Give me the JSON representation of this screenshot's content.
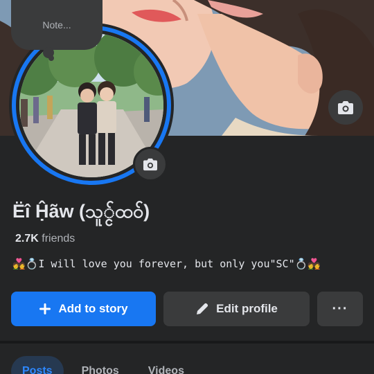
{
  "note": {
    "label": "Note..."
  },
  "profile": {
    "name": "Ëî Ḥ̂ãw (သူ္င်ထ၀်)",
    "friends_count": "2.7K",
    "friends_label": "friends",
    "bio": "💑💍I will love you forever, but only you\"SC\"💍💑"
  },
  "actions": {
    "add_story": "Add to story",
    "edit_profile": "Edit profile",
    "more": "···"
  },
  "tabs": [
    {
      "label": "Posts",
      "active": true
    },
    {
      "label": "Photos",
      "active": false
    },
    {
      "label": "Videos",
      "active": false
    }
  ],
  "colors": {
    "accent": "#1877f2",
    "background": "#242526",
    "button_secondary": "#3a3b3c"
  },
  "icons": {
    "cover_camera": "camera-icon",
    "avatar_camera": "camera-icon",
    "add": "plus-icon",
    "edit": "pencil-icon",
    "more": "more-horizontal-icon"
  }
}
